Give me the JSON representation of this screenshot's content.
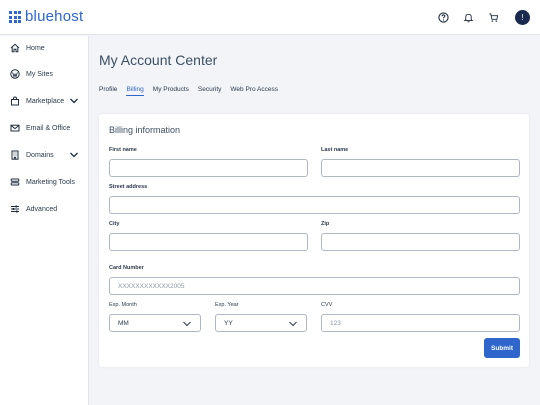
{
  "app": {
    "logo_text": "bluehost",
    "brand_color": "#2e66cc"
  },
  "header": {
    "icons": [
      "help-icon",
      "bell-icon",
      "cart-icon"
    ],
    "avatar_initial": "!"
  },
  "sidebar": {
    "items": [
      {
        "label": "Home",
        "icon": "home-icon"
      },
      {
        "label": "My Sites",
        "icon": "wordpress-icon"
      },
      {
        "label": "Marketplace",
        "icon": "shopping-bag-icon",
        "has_chevron": true
      },
      {
        "label": "Email & Office",
        "icon": "mail-icon"
      },
      {
        "label": "Domains",
        "icon": "building-icon",
        "has_chevron": true
      },
      {
        "label": "Marketing Tools",
        "icon": "stack-icon"
      },
      {
        "label": "Advanced",
        "icon": "sliders-icon"
      }
    ]
  },
  "main": {
    "title": "My Account Center",
    "tabs": [
      {
        "label": "Profile"
      },
      {
        "label": "Billing",
        "active": true
      },
      {
        "label": "My Products"
      },
      {
        "label": "Security"
      },
      {
        "label": "Web Pro Access"
      }
    ]
  },
  "billing": {
    "title": "Billing information",
    "first_name_label": "First name",
    "last_name_label": "Last name",
    "street_label": "Street address",
    "city_label": "City",
    "zip_label": "Zip",
    "card_label": "Card Number",
    "card_placeholder": "XXXXXXXXXXXX2005",
    "exp_month_label": "Exp. Month",
    "exp_month_value": "MM",
    "exp_year_label": "Exp. Year",
    "exp_year_value": "YY",
    "cvv_label": "CVV",
    "cvv_placeholder": "123",
    "submit_label": "Submit"
  }
}
